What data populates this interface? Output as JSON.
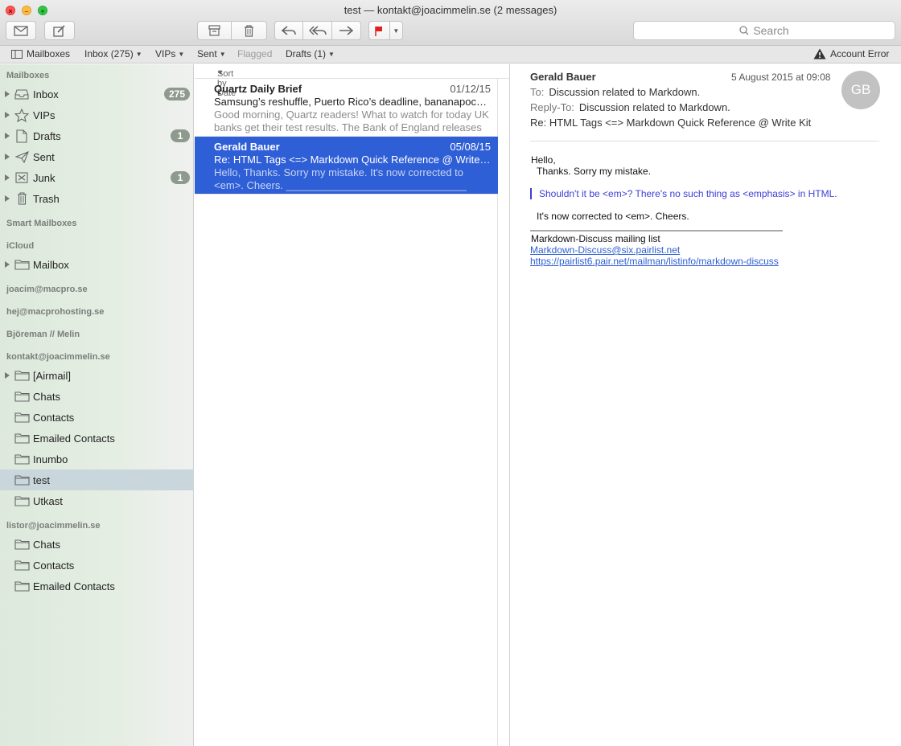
{
  "window": {
    "title": "test — kontakt@joacimmelin.se (2 messages)"
  },
  "toolbar": {
    "search_placeholder": "Search"
  },
  "favorites": {
    "mailboxes": "Mailboxes",
    "inbox": "Inbox (275)",
    "vips": "VIPs",
    "sent": "Sent",
    "flagged": "Flagged",
    "drafts": "Drafts (1)",
    "account_error": "Account Error"
  },
  "sidebar": {
    "mailboxes_header": "Mailboxes",
    "mailboxes": [
      {
        "label": "Inbox",
        "badge": "275"
      },
      {
        "label": "VIPs",
        "badge": ""
      },
      {
        "label": "Drafts",
        "badge": "1"
      },
      {
        "label": "Sent",
        "badge": ""
      },
      {
        "label": "Junk",
        "badge": "1"
      },
      {
        "label": "Trash",
        "badge": ""
      }
    ],
    "smart_header": "Smart Mailboxes",
    "icloud_header": "iCloud",
    "icloud_items": [
      {
        "label": "Mailbox"
      }
    ],
    "account1_header": "joacim@macpro.se",
    "account2_header": "hej@macprohosting.se",
    "account3_header": "Björeman // Melin",
    "account4_header": "kontakt@joacimmelin.se",
    "account4_items": [
      {
        "label": "[Airmail]"
      },
      {
        "label": "Chats"
      },
      {
        "label": "Contacts"
      },
      {
        "label": "Emailed Contacts"
      },
      {
        "label": "Inumbo"
      },
      {
        "label": "test"
      },
      {
        "label": "Utkast"
      }
    ],
    "account5_header": "listor@joacimmelin.se",
    "account5_items": [
      {
        "label": "Chats"
      },
      {
        "label": "Contacts"
      },
      {
        "label": "Emailed Contacts"
      }
    ]
  },
  "list": {
    "sort_label": "Sort by Date",
    "messages": [
      {
        "from": "Quartz Daily Brief",
        "date": "01/12/15",
        "subject": "Samsung’s reshuffle, Puerto Rico’s deadline, bananapocal...",
        "preview": "Good morning, Quartz readers! What to watch for today UK banks get their test results. The Bank of England releases t..."
      },
      {
        "from": "Gerald Bauer",
        "date": "05/08/15",
        "subject": "Re: HTML Tags <=> Markdown Quick Reference @ Write Kit",
        "preview": "Hello, Thanks. Sorry my mistake. It's now corrected to <em>. Cheers. _______________________________ Mark..."
      }
    ]
  },
  "reader": {
    "from": "Gerald Bauer",
    "date": "5 August 2015 at 09:08",
    "avatar_initials": "GB",
    "to_label": "To:",
    "to": "Discussion related to Markdown.",
    "replyto_label": "Reply-To:",
    "replyto": "Discussion related to Markdown.",
    "subject": "Re: HTML Tags <=> Markdown Quick Reference @ Write Kit",
    "body_hello": "Hello,",
    "body_thanks": "Thanks. Sorry my mistake.",
    "body_quote": "Shouldn't it be <em>? There's no such thing as <emphasis> in HTML.",
    "body_corrected": "It's now corrected to <em>. Cheers.",
    "footer_list": "Markdown-Discuss mailing list",
    "footer_email": "Markdown-Discuss@six.pairlist.net",
    "footer_url": "https://pairlist6.pair.net/mailman/listinfo/markdown-discuss"
  }
}
